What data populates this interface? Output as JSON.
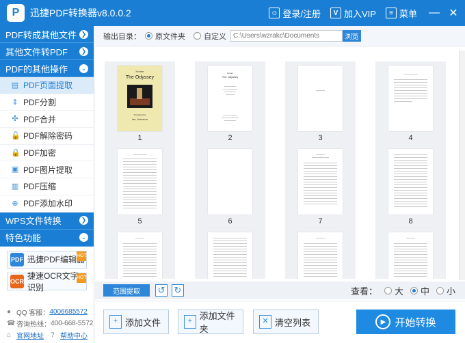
{
  "app": {
    "title": "迅捷PDF转换器v8.0.0.2",
    "logo": "P"
  },
  "titlebar": {
    "login": "登录/注册",
    "vip": "加入VIP",
    "menu": "菜单",
    "minimize": "—",
    "close": "✕"
  },
  "sidebar": {
    "cat1": "PDF转成其他文件",
    "cat2": "其他文件转PDF",
    "cat3": "PDF的其他操作",
    "items": [
      {
        "label": "PDF页面提取",
        "icon": "page-extract-icon",
        "glyph": "▤"
      },
      {
        "label": "PDF分割",
        "icon": "split-icon",
        "glyph": "⇕"
      },
      {
        "label": "PDF合并",
        "icon": "merge-icon",
        "glyph": "✣"
      },
      {
        "label": "PDF解除密码",
        "icon": "unlock-icon",
        "glyph": "🔓"
      },
      {
        "label": "PDF加密",
        "icon": "lock-icon",
        "glyph": "🔒"
      },
      {
        "label": "PDF图片提取",
        "icon": "image-extract-icon",
        "glyph": "▣"
      },
      {
        "label": "PDF压缩",
        "icon": "compress-icon",
        "glyph": "▥"
      },
      {
        "label": "PDF添加水印",
        "icon": "watermark-icon",
        "glyph": "⊕"
      }
    ],
    "cat4": "WPS文件转换",
    "cat5": "特色功能",
    "promo1": "迅捷PDF编辑器",
    "promo1_icon": "PDF",
    "promo2": "捷速OCR文字识别",
    "promo2_icon": "OCR",
    "ribbon": "HOT",
    "qq_label": "QQ 客服：",
    "qq_value": "4006685572",
    "phone_label": "咨询热线：",
    "phone_value": "400-668-5572",
    "site": "官网地址",
    "help": "帮助中心"
  },
  "output": {
    "label": "输出目录：",
    "opt_original": "原文件夹",
    "opt_custom": "自定义",
    "path_placeholder": "C:\\Users\\wzrakc\\Documents",
    "browse": "浏览"
  },
  "pages": [
    "1",
    "2",
    "3",
    "4",
    "5",
    "6",
    "7",
    "8"
  ],
  "cover": {
    "author": "Homer",
    "title": "The Odyssey",
    "translator": "Translated by",
    "translator_name": "Ian Johnston"
  },
  "page2": {
    "title": "Homer",
    "subtitle": "The Odyssey"
  },
  "controls": {
    "range_extract": "范围提取",
    "rotate_left": "↺",
    "rotate_right": "↻",
    "view_label": "查看：",
    "view_large": "大",
    "view_medium": "中",
    "view_small": "小",
    "view_selected": "中"
  },
  "actions": {
    "add_file": "添加文件",
    "add_folder": "添加文件夹",
    "clear_list": "清空列表",
    "start": "开始转换"
  }
}
